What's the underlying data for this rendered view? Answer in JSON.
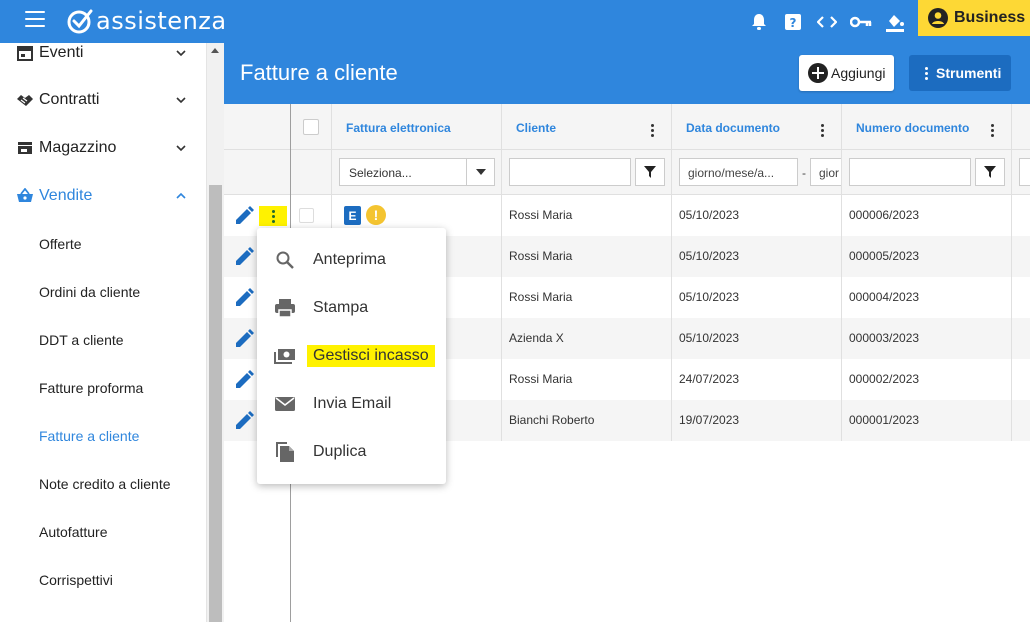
{
  "app": {
    "logo_text": "assistenza",
    "plan_label": "Business"
  },
  "sidebar": {
    "items": [
      {
        "label": "Eventi"
      },
      {
        "label": "Contratti"
      },
      {
        "label": "Magazzino"
      },
      {
        "label": "Vendite"
      }
    ],
    "sub_items": [
      {
        "label": "Offerte"
      },
      {
        "label": "Ordini da cliente"
      },
      {
        "label": "DDT a cliente"
      },
      {
        "label": "Fatture proforma"
      },
      {
        "label": "Fatture a cliente"
      },
      {
        "label": "Note credito a cliente"
      },
      {
        "label": "Autofatture"
      },
      {
        "label": "Corrispettivi"
      }
    ]
  },
  "page": {
    "title": "Fatture a cliente",
    "add_label": "Aggiungi",
    "tools_label": "Strumenti"
  },
  "table": {
    "columns": [
      {
        "label": "Fattura elettronica"
      },
      {
        "label": "Cliente"
      },
      {
        "label": "Data documento"
      },
      {
        "label": "Numero documento"
      }
    ],
    "filters": {
      "einvoice_select": "Seleziona...",
      "date_from_placeholder": "giorno/mese/a...",
      "date_separator": "-",
      "date_to_placeholder": "gior"
    },
    "rows": [
      {
        "cliente": "Rossi Maria",
        "data": "05/10/2023",
        "numero": "000006/2023",
        "badge_e": "E",
        "badge_warn": "!"
      },
      {
        "cliente": "Rossi Maria",
        "data": "05/10/2023",
        "numero": "000005/2023"
      },
      {
        "cliente": "Rossi Maria",
        "data": "05/10/2023",
        "numero": "000004/2023"
      },
      {
        "cliente": "Azienda X",
        "data": "05/10/2023",
        "numero": "000003/2023"
      },
      {
        "cliente": "Rossi Maria",
        "data": "24/07/2023",
        "numero": "000002/2023"
      },
      {
        "cliente": "Bianchi Roberto",
        "data": "19/07/2023",
        "numero": "000001/2023"
      }
    ]
  },
  "context_menu": {
    "items": [
      {
        "label": "Anteprima"
      },
      {
        "label": "Stampa"
      },
      {
        "label": "Gestisci incasso"
      },
      {
        "label": "Invia Email"
      },
      {
        "label": "Duplica"
      }
    ]
  },
  "colors": {
    "primary": "#2f86dd",
    "primary_dark": "#1c6cc0",
    "highlight": "#fff200",
    "business": "#fdd835",
    "warning": "#f4c430"
  }
}
